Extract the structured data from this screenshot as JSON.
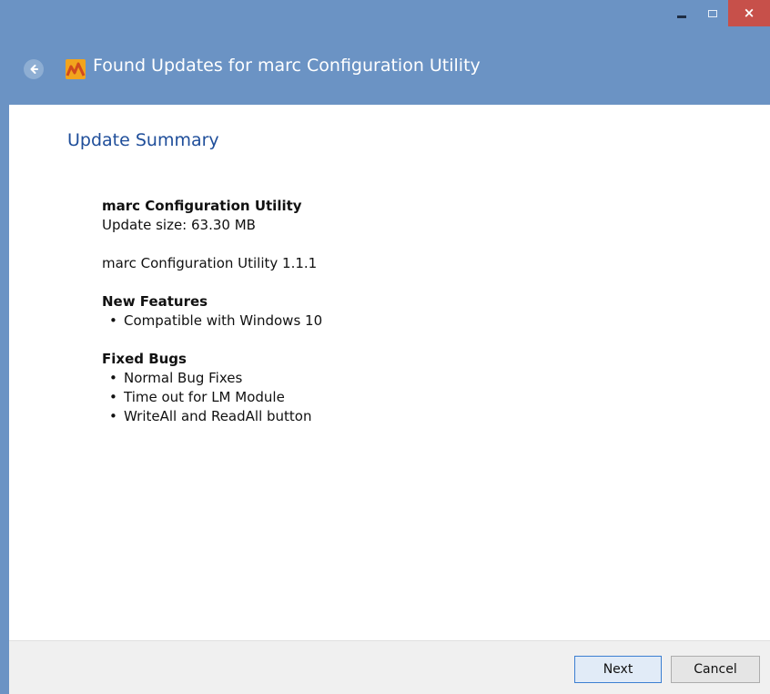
{
  "window": {
    "title": "Found Updates for marc Configuration Utility",
    "close_glyph": "×"
  },
  "content": {
    "heading": "Update Summary",
    "product_name": "marc Configuration Utility",
    "update_size": "Update size: 63.30 MB",
    "version_line": "marc Configuration Utility 1.1.1",
    "new_features": {
      "heading": "New Features",
      "items": [
        "Compatible with Windows 10"
      ]
    },
    "fixed_bugs": {
      "heading": "Fixed Bugs",
      "items": [
        "Normal Bug Fixes",
        "Time out for LM Module",
        "WriteAll and ReadAll button"
      ]
    }
  },
  "footer": {
    "next_label": "Next",
    "cancel_label": "Cancel"
  },
  "icons": {
    "back": "back-arrow-icon",
    "app": "marc-app-icon",
    "minimize": "minimize-icon",
    "maximize": "maximize-icon",
    "close": "close-icon"
  },
  "colors": {
    "titlebar": "#6b93c4",
    "heading_blue": "#1f4e9a",
    "close_red": "#c7504a"
  }
}
